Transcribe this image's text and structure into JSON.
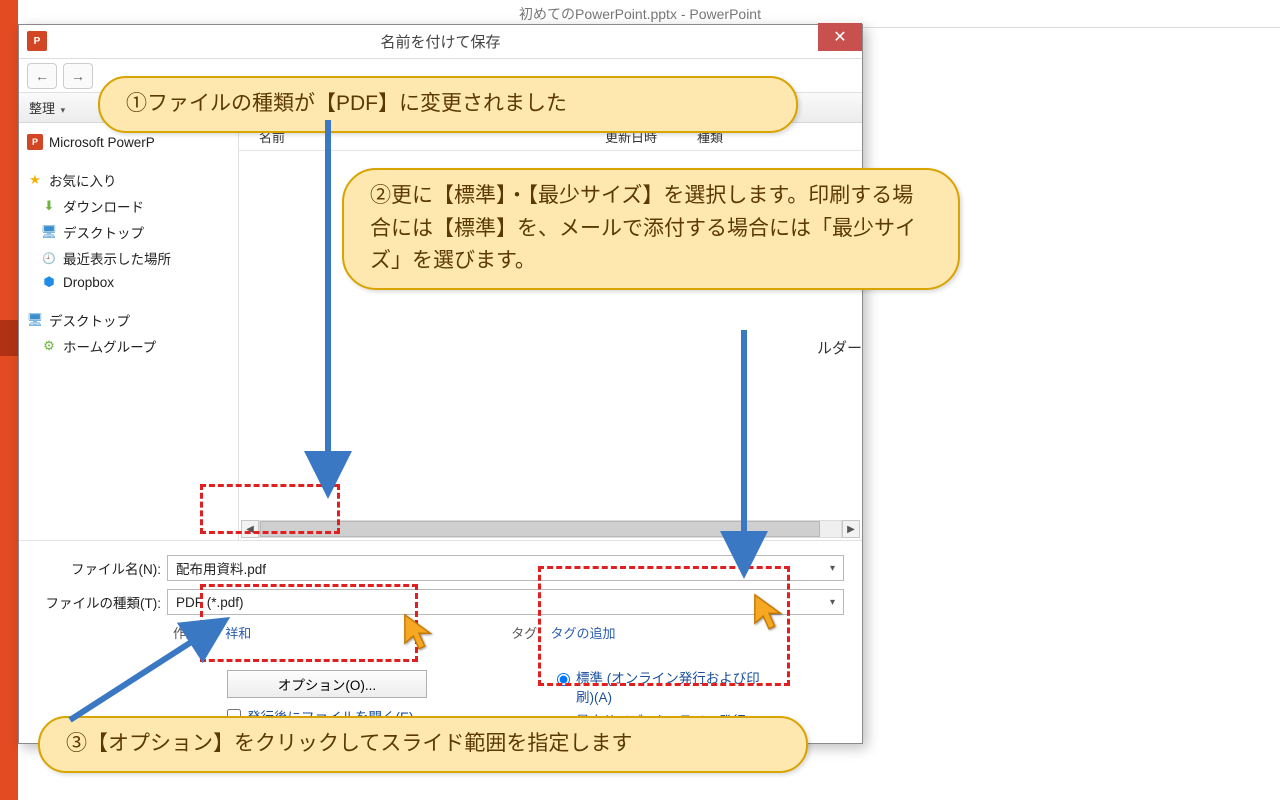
{
  "app": {
    "window_title": "初めてのPowerPoint.pptx - PowerPoint"
  },
  "dialog": {
    "title": "名前を付けて保存",
    "pp_icon_text": "P",
    "close_x": "✕",
    "toolbar": {
      "organize": "整理",
      "chev": "▾"
    },
    "columns": {
      "name": "名前",
      "updated": "更新日時",
      "type": "種類"
    },
    "sidebar": {
      "ms_pp": "Microsoft PowerP",
      "fav": "お気に入り",
      "downloads": "ダウンロード",
      "desktop": "デスクトップ",
      "recent": "最近表示した場所",
      "dropbox": "Dropbox",
      "desktop2": "デスクトップ",
      "homegroup": "ホームグループ"
    },
    "folder_tail": "ルダー",
    "filename_label": "ファイル名(N):",
    "filename_value": "配布用資料.pdf",
    "filetype_label": "ファイルの種類(T):",
    "filetype_value": "PDF (*.pdf)",
    "author_label": "作成者:",
    "author_value": "祥和",
    "tag_label": "タグ:",
    "tag_value": "タグの追加",
    "options_btn": "オプション(O)...",
    "open_after": "発行後にファイルを開く(E)",
    "opt_standard": "標準 (オンライン発行および印刷)(A)",
    "opt_min": "最小サイズ (オンライン発行)(M)"
  },
  "callouts": {
    "c1": "①ファイルの種類が【PDF】に変更されました",
    "c2": "②更に【標準】・【最少サイズ】を選択します。印刷する場合には【標準】を、メールで添付する場合には「最少サイズ」を選びます。",
    "c3": "③【オプション】をクリックしてスライド範囲を指定します"
  }
}
